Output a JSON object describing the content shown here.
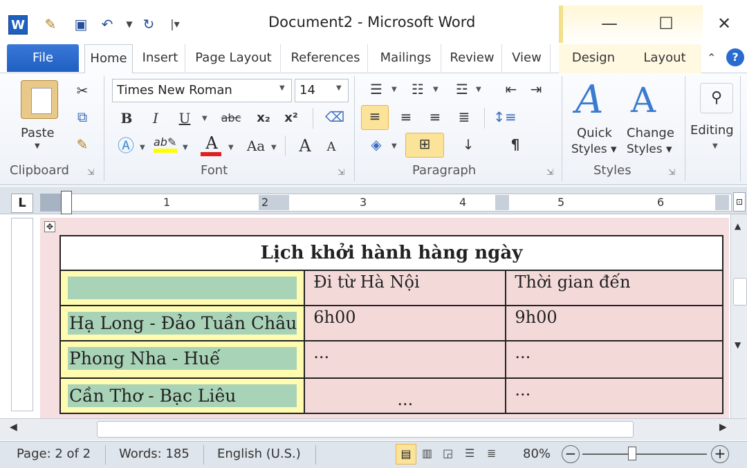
{
  "window": {
    "title": "Document2  -  Microsoft Word",
    "minimize": "—",
    "maximize": "☐",
    "close": "✕"
  },
  "tabs": {
    "file": "File",
    "home": "Home",
    "insert": "Insert",
    "page_layout": "Page Layout",
    "references": "References",
    "mailings": "Mailings",
    "review": "Review",
    "view": "View",
    "design": "Design",
    "layout": "Layout"
  },
  "ribbon": {
    "clipboard": {
      "paste": "Paste",
      "group": "Clipboard"
    },
    "font": {
      "family": "Times New Roman",
      "size": "14",
      "bold": "B",
      "italic": "I",
      "underline": "U",
      "strike": "abc",
      "subscript": "x₂",
      "superscript": "x²",
      "grow": "A",
      "shrink": "A",
      "change_case": "Aa",
      "font_color": "A",
      "group": "Font"
    },
    "paragraph": {
      "show_marks": "¶",
      "group": "Paragraph"
    },
    "styles": {
      "quick": "Quick",
      "quick2": "Styles ▾",
      "change": "Change",
      "change2": "Styles ▾",
      "group": "Styles"
    },
    "editing": {
      "label": "Editing"
    }
  },
  "ruler": {
    "corner": "L",
    "numbers": [
      "1",
      "2",
      "3",
      "4",
      "5",
      "6"
    ]
  },
  "table": {
    "title": "Lịch khởi hành hàng ngày",
    "header": [
      "",
      "Đi từ Hà Nội",
      "Thời gian đến"
    ],
    "rows": [
      [
        "Hạ Long - Đảo Tuần Châu",
        "6h00",
        "9h00"
      ],
      [
        "Phong Nha - Huế",
        "...",
        "..."
      ],
      [
        "Cần Thơ - Bạc Liêu",
        "...",
        "..."
      ]
    ]
  },
  "status": {
    "page": "Page: 2 of 2",
    "words": "Words: 185",
    "language": "English (U.S.)",
    "zoom": "80%",
    "zoom_out": "−",
    "zoom_in": "+"
  },
  "colors": {
    "file_tab": "#2a6bd0",
    "doc_bg": "#f6dfe0",
    "col1": "#fffbb0",
    "cell_green": "#a9d3b7",
    "highlight": "#fbe39a"
  }
}
